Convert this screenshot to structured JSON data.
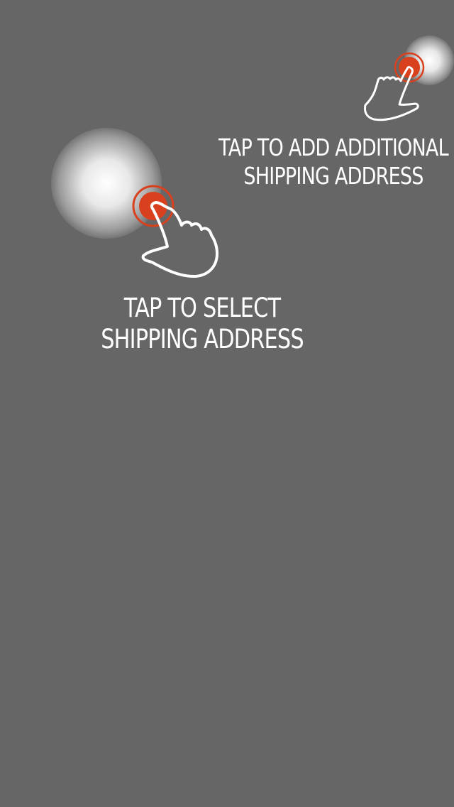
{
  "colors": {
    "backdrop": "#666666",
    "accent": "#d9411e",
    "text": "#ffffff"
  },
  "hints": {
    "add_address": {
      "line1": "TAP TO ADD ADDITIONAL",
      "line2": "SHIPPING ADDRESS",
      "icon": "tap-hand-icon"
    },
    "select_address": {
      "line1": "TAP TO SELECT",
      "line2": "SHIPPING ADDRESS",
      "icon": "tap-hand-icon"
    }
  }
}
